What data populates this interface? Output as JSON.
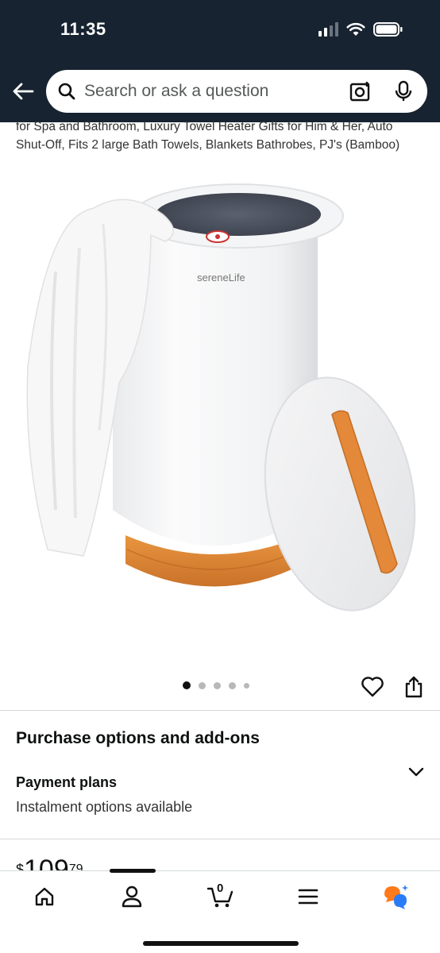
{
  "status_bar": {
    "time": "11:35"
  },
  "search": {
    "placeholder": "Search or ask a question"
  },
  "product": {
    "title": "for Spa and Bathroom, Luxury Towel Heater Gifts for Him & Her, Auto Shut-Off, Fits 2 large Bath Towels, Blankets Bathrobes, PJ's (Bamboo)",
    "brand_label": "sereneLife"
  },
  "carousel": {
    "total_images": 5,
    "active_index": 0
  },
  "purchase_section": {
    "title": "Purchase options and add-ons",
    "payment_plans_title": "Payment plans",
    "payment_plans_subtitle": "Instalment options available"
  },
  "price": {
    "symbol": "$",
    "whole": "109",
    "fraction": "79"
  },
  "bottom_nav": {
    "cart_count": "0",
    "items": [
      "home-icon",
      "account-icon",
      "cart-icon",
      "menu-icon",
      "rufus-icon"
    ]
  },
  "colors": {
    "header_bg": "#172330",
    "wood": "#e08a3c",
    "rufus_orange": "#ff7a1a",
    "rufus_blue": "#2a7cf6"
  }
}
